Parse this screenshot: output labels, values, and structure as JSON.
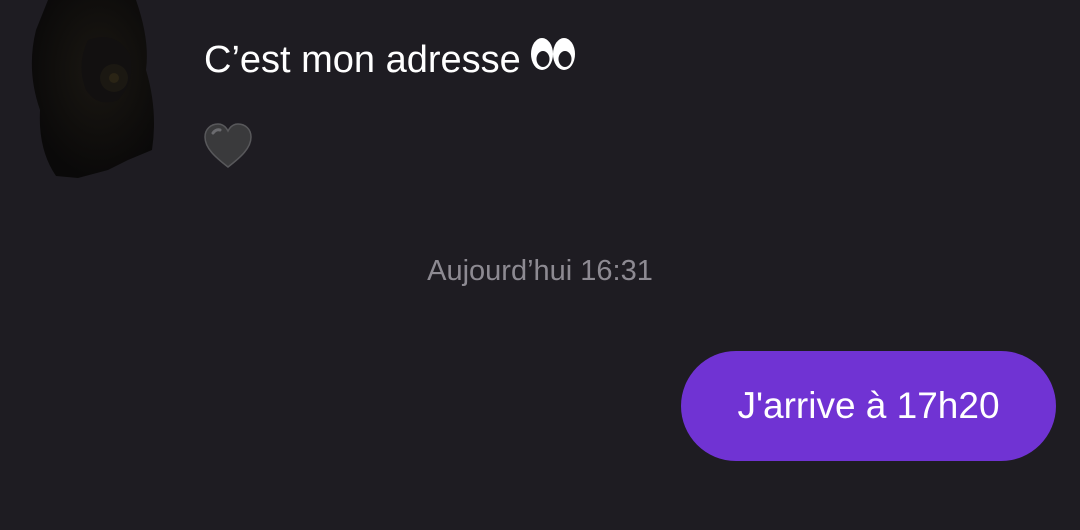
{
  "conversation": {
    "incoming": {
      "message_text": "C’est mon adresse",
      "message_emoji": "eyes-emoji",
      "reaction_emoji": "black-heart-emoji"
    },
    "timestamp": "Aujourd’hui 16:31",
    "outgoing": {
      "message_text": "J'arrive à 17h20"
    }
  },
  "colors": {
    "background": "#1e1c22",
    "outgoing_bubble": "#7033d3",
    "text_primary": "#ffffff",
    "timestamp_text": "#8d8a92"
  }
}
